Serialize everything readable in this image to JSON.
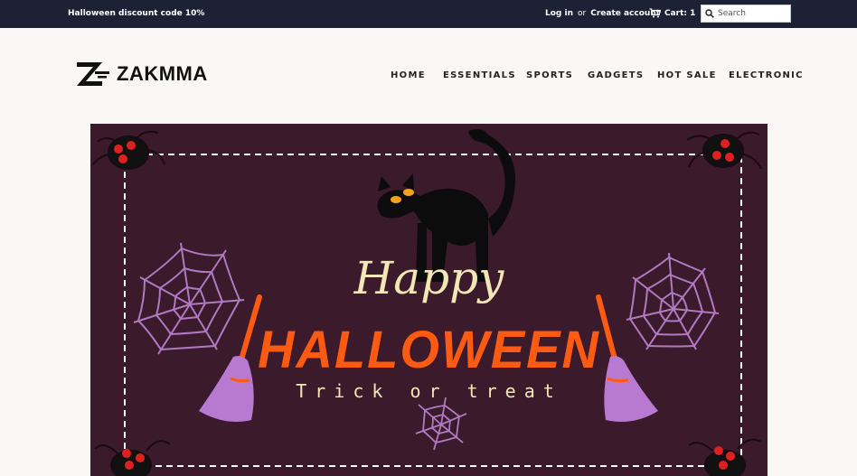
{
  "topbar": {
    "promo": "Halloween discount code 10%",
    "login": "Log in",
    "or": "or",
    "create_account": "Create account",
    "cart": "Cart: 1",
    "search_placeholder": "Search"
  },
  "header": {
    "logo_text": "ZAKMMA",
    "nav": [
      "HOME",
      "ESSENTIALS",
      "SPORTS",
      "GADGETS",
      "HOT SALE",
      "ELECTRONIC"
    ]
  },
  "banner": {
    "line1": "Happy",
    "line2": "HALLOWEEN",
    "line3": "Trick or treat"
  },
  "colors": {
    "topbar_bg": "#1d2136",
    "banner_bg": "#3a1a2b",
    "accent_orange": "#ff5a12",
    "cream": "#f3e7b6",
    "web_purple": "#b07ac2"
  }
}
